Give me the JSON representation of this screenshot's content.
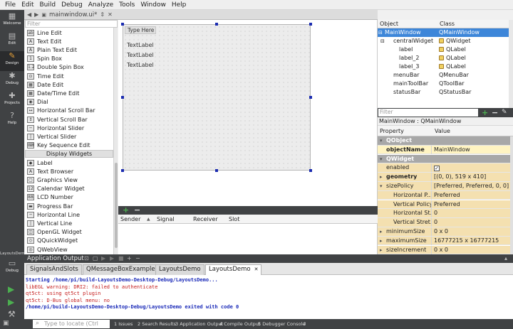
{
  "menu": [
    "File",
    "Edit",
    "Build",
    "Debug",
    "Analyze",
    "Tools",
    "Window",
    "Help"
  ],
  "modes": [
    {
      "label": "Welcome",
      "icon": "welcome-icon",
      "glyph": "▦"
    },
    {
      "label": "Edit",
      "icon": "edit-icon",
      "glyph": "▤"
    },
    {
      "label": "Design",
      "icon": "design-icon",
      "glyph": "✎"
    },
    {
      "label": "Debug",
      "icon": "debug-icon",
      "glyph": "✱"
    },
    {
      "label": "Projects",
      "icon": "projects-icon",
      "glyph": "✚"
    },
    {
      "label": "Help",
      "icon": "help-icon",
      "glyph": "?"
    }
  ],
  "kit": {
    "name": "LayoutsDemo",
    "mode": "Debug"
  },
  "doc": {
    "file": "mainwindow.ui*"
  },
  "widgetbox": {
    "filter_placeholder": "Filter",
    "items_a": [
      "Line Edit",
      "Text Edit",
      "Plain Text Edit",
      "Spin Box",
      "Double Spin Box",
      "Time Edit",
      "Date Edit",
      "Date/Time Edit",
      "Dial",
      "Horizontal Scroll Bar",
      "Vertical Scroll Bar",
      "Horizontal Slider",
      "Vertical Slider",
      "Key Sequence Edit"
    ],
    "category": "Display Widgets",
    "items_b": [
      "Label",
      "Text Browser",
      "Graphics View",
      "Calendar Widget",
      "LCD Number",
      "Progress Bar",
      "Horizontal Line",
      "Vertical Line",
      "OpenGL Widget",
      "QQuickWidget",
      "QWebView"
    ]
  },
  "form": {
    "menu_placeholder": "Type Here",
    "labels": [
      "TextLabel",
      "TextLabel",
      "TextLabel"
    ]
  },
  "signals": {
    "columns": [
      "Sender",
      "Signal",
      "Receiver",
      "Slot"
    ]
  },
  "object_inspector": {
    "columns": [
      "Object",
      "Class"
    ],
    "rows": [
      {
        "object": "MainWindow",
        "class": "QMainWindow"
      },
      {
        "object": "centralWidget",
        "class": "QWidget"
      },
      {
        "object": "label",
        "class": "QLabel"
      },
      {
        "object": "label_2",
        "class": "QLabel"
      },
      {
        "object": "label_3",
        "class": "QLabel"
      },
      {
        "object": "menuBar",
        "class": "QMenuBar"
      },
      {
        "object": "mainToolBar",
        "class": "QToolBar"
      },
      {
        "object": "statusBar",
        "class": "QStatusBar"
      }
    ]
  },
  "property_editor": {
    "filter_placeholder": "Filter",
    "context": "MainWindow : QMainWindow",
    "columns": [
      "Property",
      "Value"
    ],
    "rows": [
      {
        "name": "QObject",
        "value": ""
      },
      {
        "name": "objectName",
        "value": "MainWindow"
      },
      {
        "name": "QWidget",
        "value": ""
      },
      {
        "name": "enabled",
        "value": "✓"
      },
      {
        "name": "geometry",
        "value": "[(0, 0), 519 x 410]"
      },
      {
        "name": "sizePolicy",
        "value": "[Preferred, Preferred, 0, 0]"
      },
      {
        "name": "Horizontal P...",
        "value": "Preferred"
      },
      {
        "name": "Vertical Policy",
        "value": "Preferred"
      },
      {
        "name": "Horizontal St...",
        "value": "0"
      },
      {
        "name": "Vertical Stret...",
        "value": "0"
      },
      {
        "name": "minimumSize",
        "value": "0 x 0"
      },
      {
        "name": "maximumSize",
        "value": "16777215 x 16777215"
      },
      {
        "name": "sizeIncrement",
        "value": "0 x 0"
      }
    ]
  },
  "output": {
    "title": "Application Output",
    "tabs": [
      "SignalsAndSlots",
      "QMessageBoxExample",
      "LayoutsDemo",
      "LayoutsDemo"
    ],
    "lines": [
      {
        "text": "Starting /home/pi/build-LayoutsDemo-Desktop-Debug/LayoutsDemo...",
        "color": "#1a2ab8"
      },
      {
        "text": "libEGL warning: DRI2: failed to authenticate",
        "color": "#c41a1a"
      },
      {
        "text": "qt5ct: using qt5ct plugin",
        "color": "#c41a1a"
      },
      {
        "text": "qt5ct: D-Bus global menu: no",
        "color": "#c41a1a"
      },
      {
        "text": "/home/pi/build-LayoutsDemo-Desktop-Debug/LayoutsDemo exited with code 0",
        "color": "#1a2ab8"
      }
    ]
  },
  "statusbar": {
    "locate_placeholder": "Type to locate (Ctrl",
    "panes": [
      "1  Issues",
      "2  Search Results",
      "3  Application Output",
      "4  Compile Output",
      "5  Debugger Console"
    ]
  }
}
